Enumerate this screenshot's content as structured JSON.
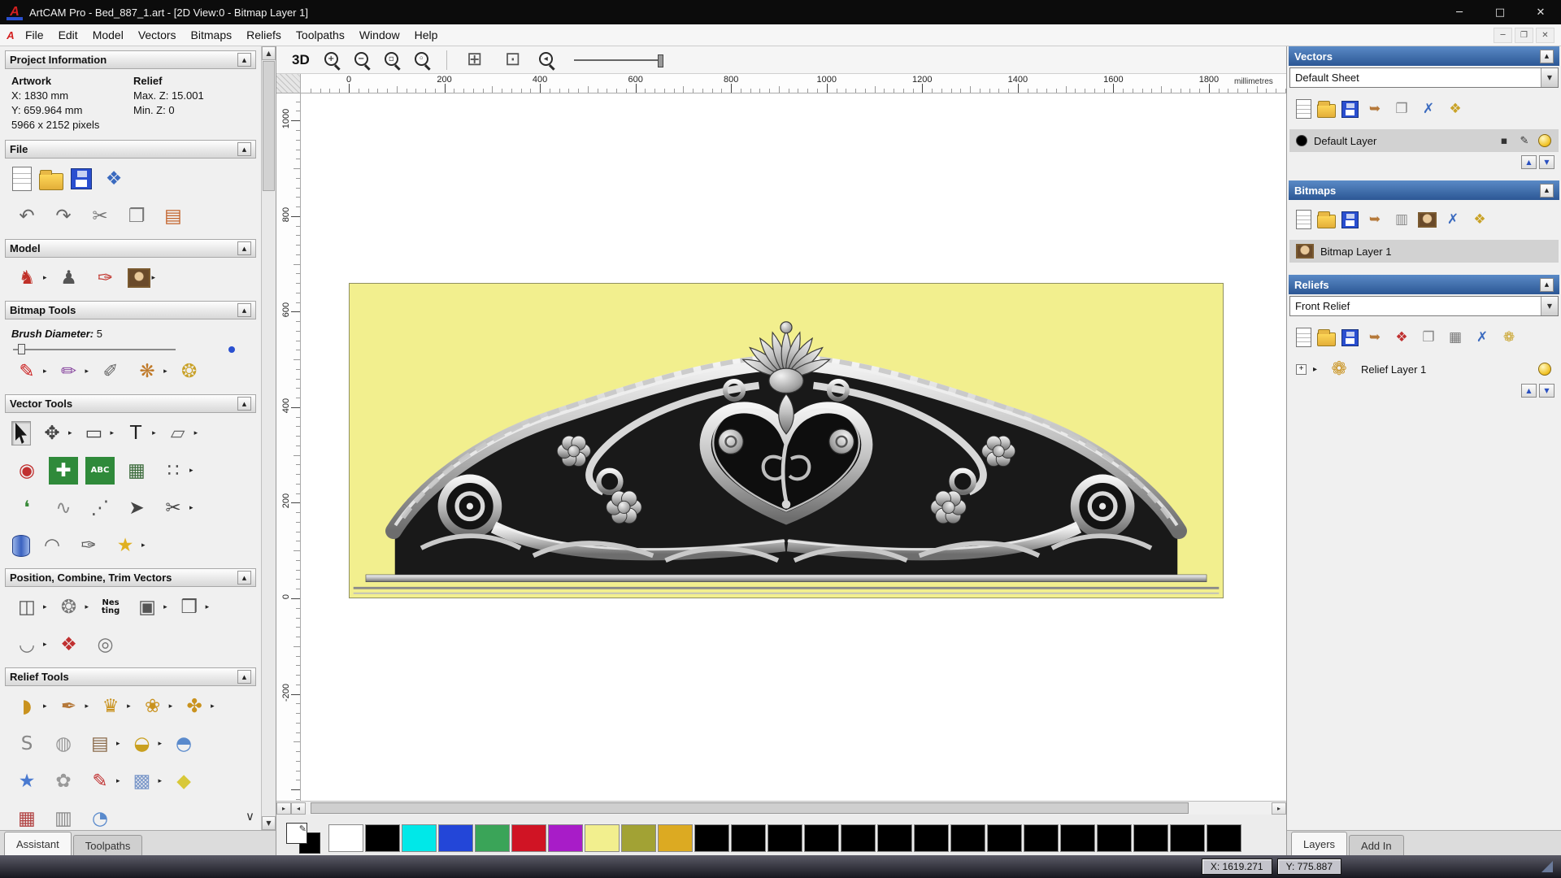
{
  "ui": {
    "collapse_glyph": "▲",
    "dropdown_glyph": "▼",
    "flyout_glyph": "▸",
    "up_glyph": "▲",
    "down_glyph": "▼",
    "left_glyph": "◂",
    "right_glyph": "▸",
    "more_glyph": "∨",
    "plus_glyph": "+",
    "pencil_glyph": "✎"
  },
  "window": {
    "logo_letter": "A",
    "title": "ArtCAM Pro - Bed_887_1.art - [2D View:0 - Bitmap Layer 1]",
    "buttons": [
      {
        "name": "minimize-button",
        "glyph": "─"
      },
      {
        "name": "maximize-button",
        "glyph": "□"
      },
      {
        "name": "close-button",
        "glyph": "✕"
      }
    ]
  },
  "menu": {
    "items": [
      "File",
      "Edit",
      "Model",
      "Vectors",
      "Bitmaps",
      "Reliefs",
      "Toolpaths",
      "Window",
      "Help"
    ],
    "mdi_buttons": [
      {
        "name": "mdi-minimize-button",
        "glyph": "─"
      },
      {
        "name": "mdi-restore-button",
        "glyph": "❐"
      },
      {
        "name": "mdi-close-button",
        "glyph": "✕"
      }
    ]
  },
  "left_panel": {
    "project_info": {
      "title": "Project Information",
      "artwork_label": "Artwork",
      "relief_label": "Relief",
      "x_value": "X: 1830 mm",
      "max_z": "Max. Z: 15.001",
      "y_value": "Y: 659.964 mm",
      "min_z": "Min. Z: 0",
      "pixels": "5966 x 2152 pixels"
    },
    "file": {
      "title": "File",
      "rows": [
        [
          {
            "name": "new-model-icon",
            "type": "page"
          },
          {
            "name": "open-model-icon",
            "type": "folder"
          },
          {
            "name": "save-model-icon",
            "type": "floppy"
          },
          {
            "name": "import-3d-model-icon",
            "type": "glyph",
            "glyph": "❖",
            "color": "#3a6abf"
          }
        ],
        [
          {
            "name": "undo-icon",
            "type": "glyph",
            "glyph": "↶",
            "color": "#666666"
          },
          {
            "name": "redo-icon",
            "type": "glyph",
            "glyph": "↷",
            "color": "#666666"
          },
          {
            "name": "cut-icon",
            "type": "glyph",
            "glyph": "✂",
            "color": "#777777"
          },
          {
            "name": "copy-icon",
            "type": "glyph",
            "glyph": "❐",
            "color": "#777777"
          },
          {
            "name": "paste-icon",
            "type": "glyph",
            "glyph": "▤",
            "color": "#c2622a"
          }
        ]
      ]
    },
    "model": {
      "title": "Model",
      "rows": [
        [
          {
            "name": "relief-from-model-icon",
            "type": "glyph",
            "glyph": "♞",
            "color": "#c03028",
            "flyout": true
          },
          {
            "name": "greyscale-model-icon",
            "type": "glyph",
            "glyph": "♟",
            "color": "#555555"
          },
          {
            "name": "sculpt-model-icon",
            "type": "glyph",
            "glyph": "✑",
            "color": "#c03028"
          },
          {
            "name": "model-image-icon",
            "type": "photo",
            "flyout": true
          }
        ]
      ]
    },
    "bitmap_tools": {
      "title": "Bitmap Tools",
      "brush_label": "Brush Diameter:",
      "brush_value": "5",
      "rows": [
        [
          {
            "name": "paint-icon",
            "type": "glyph",
            "glyph": "✎",
            "color": "#cc2020",
            "flyout": true
          },
          {
            "name": "paint-selective-icon",
            "type": "glyph",
            "glyph": "✏",
            "color": "#8a4aa0",
            "flyout": true
          },
          {
            "name": "colour-picker-icon",
            "type": "glyph",
            "glyph": "✐",
            "color": "#666666"
          },
          {
            "name": "palette-icon",
            "type": "glyph",
            "glyph": "❋",
            "color": "#c07a2a",
            "flyout": true
          },
          {
            "name": "flood-fill-icon",
            "type": "glyph",
            "glyph": "❂",
            "color": "#c9a22a"
          }
        ]
      ]
    },
    "vector_tools": {
      "title": "Vector Tools",
      "rows": [
        [
          {
            "name": "select-vectors-icon",
            "type": "cursor",
            "pressed": true
          },
          {
            "name": "transform-vectors-icon",
            "type": "glyph",
            "glyph": "✥",
            "color": "#444444",
            "flyout": true
          },
          {
            "name": "create-rectangle-icon",
            "type": "glyph",
            "glyph": "▭",
            "color": "#444444",
            "flyout": true
          },
          {
            "name": "create-text-icon",
            "type": "glyph",
            "glyph": "T",
            "color": "#222222",
            "flyout": true
          },
          {
            "name": "mirror-vectors-icon",
            "type": "glyph",
            "glyph": "▱",
            "color": "#666666",
            "flyout": true
          }
        ],
        [
          {
            "name": "offset-vectors-icon",
            "type": "glyph",
            "glyph": "◉",
            "color": "#c03030"
          },
          {
            "name": "create-polyline-icon",
            "type": "glyph",
            "glyph": "✚",
            "color": "#ffffff",
            "bg": "#2f8a3a"
          },
          {
            "name": "text-on-curve-icon",
            "type": "text2",
            "text": "ABC",
            "text2": "",
            "bg": "#2f8a3a",
            "color": "#ffffff"
          },
          {
            "name": "grid-icon",
            "type": "glyph",
            "glyph": "▦",
            "color": "#3a6a3a"
          },
          {
            "name": "snap-grid-icon",
            "type": "glyph",
            "glyph": "∷",
            "color": "#555555",
            "flyout": true
          }
        ],
        [
          {
            "name": "create-curve-icon",
            "type": "glyph",
            "glyph": "❛",
            "color": "#3a8a3a"
          },
          {
            "name": "free-curve-icon",
            "type": "glyph",
            "glyph": "∿",
            "color": "#888888"
          },
          {
            "name": "node-editing-icon",
            "type": "glyph",
            "glyph": "⋰",
            "color": "#555555"
          },
          {
            "name": "measure-icon",
            "type": "glyph",
            "glyph": "➤",
            "color": "#444444"
          },
          {
            "name": "trim-vectors-icon",
            "type": "glyph",
            "glyph": "✂",
            "color": "#444444",
            "flyout": true
          }
        ],
        [
          {
            "name": "wrap-cylinder-icon",
            "type": "cyl"
          },
          {
            "name": "arc-icon",
            "type": "glyph",
            "glyph": "◠",
            "color": "#666666"
          },
          {
            "name": "freehand-draw-icon",
            "type": "glyph",
            "glyph": "✑",
            "color": "#555555"
          },
          {
            "name": "magic-wand-icon",
            "type": "glyph",
            "glyph": "★",
            "color": "#e0b020",
            "flyout": true
          }
        ]
      ]
    },
    "position_tools": {
      "title": "Position, Combine, Trim Vectors",
      "rows": [
        [
          {
            "name": "block-copy-icon",
            "type": "glyph",
            "glyph": "◫",
            "color": "#555555",
            "flyout": true
          },
          {
            "name": "rotate-copy-icon",
            "type": "glyph",
            "glyph": "❂",
            "color": "#777777",
            "flyout": true
          },
          {
            "name": "nesting-icon",
            "type": "text2",
            "text": "Nes",
            "text2": "ting",
            "color": "#111111"
          },
          {
            "name": "align-objects-icon",
            "type": "glyph",
            "glyph": "▣",
            "color": "#555555",
            "flyout": true
          },
          {
            "name": "group-vectors-icon",
            "type": "glyph",
            "glyph": "❒",
            "color": "#555555",
            "flyout": true
          }
        ],
        [
          {
            "name": "join-vectors-icon",
            "type": "glyph",
            "glyph": "◡",
            "color": "#777777",
            "flyout": true
          },
          {
            "name": "weld-vectors-icon",
            "type": "glyph",
            "glyph": "❖",
            "color": "#c03030"
          },
          {
            "name": "spiral-icon",
            "type": "glyph",
            "glyph": "◎",
            "color": "#777777"
          }
        ]
      ]
    },
    "relief_tools": {
      "title": "Relief Tools",
      "rows": [
        [
          {
            "name": "shape-editor-icon",
            "type": "glyph",
            "glyph": "◗",
            "color": "#c9921e",
            "flyout": true
          },
          {
            "name": "smooth-relief-icon",
            "type": "glyph",
            "glyph": "✒",
            "color": "#b5793a",
            "flyout": true
          },
          {
            "name": "two-rail-sweep-icon",
            "type": "glyph",
            "glyph": "♛",
            "color": "#c9921e",
            "flyout": true
          },
          {
            "name": "extrude-icon",
            "type": "glyph",
            "glyph": "❀",
            "color": "#c9921e",
            "flyout": true
          },
          {
            "name": "turn-icon",
            "type": "glyph",
            "glyph": "✤",
            "color": "#c9921e",
            "flyout": true
          }
        ],
        [
          {
            "name": "isolines-icon",
            "type": "glyph",
            "glyph": "S",
            "color": "#888888"
          },
          {
            "name": "weave-wizard-icon",
            "type": "glyph",
            "glyph": "◍",
            "color": "#999999"
          },
          {
            "name": "relief-layers-icon",
            "type": "glyph",
            "glyph": "▤",
            "color": "#8a6a4a",
            "flyout": true
          },
          {
            "name": "dome-icon",
            "type": "glyph",
            "glyph": "◒",
            "color": "#c9a020",
            "flyout": true
          },
          {
            "name": "texture-dome-icon",
            "type": "glyph",
            "glyph": "◓",
            "color": "#5a8acc"
          }
        ],
        [
          {
            "name": "star-wizard-icon",
            "type": "glyph",
            "glyph": "★",
            "color": "#4a7ad0"
          },
          {
            "name": "swirl-icon",
            "type": "glyph",
            "glyph": "✿",
            "color": "#999999"
          },
          {
            "name": "smudge-icon",
            "type": "glyph",
            "glyph": "✎",
            "color": "#c03030",
            "flyout": true
          },
          {
            "name": "texture-relief-icon",
            "type": "glyph",
            "glyph": "▩",
            "color": "#7a97c9",
            "flyout": true
          },
          {
            "name": "offset-relief-icon",
            "type": "glyph",
            "glyph": "◆",
            "color": "#d8c838"
          }
        ],
        [
          {
            "name": "clipped-tool-icon-1",
            "type": "glyph",
            "glyph": "▦",
            "color": "#b04040"
          },
          {
            "name": "clipped-tool-icon-2",
            "type": "glyph",
            "glyph": "▥",
            "color": "#888888"
          },
          {
            "name": "clipped-tool-icon-3",
            "type": "glyph",
            "glyph": "◔",
            "color": "#5a8acc"
          }
        ]
      ]
    },
    "tabs": [
      {
        "label": "Assistant",
        "active": true
      },
      {
        "label": "Toolpaths",
        "active": false
      }
    ]
  },
  "canvas": {
    "toolbar": {
      "view_3d_label": "3D",
      "icons": [
        {
          "name": "zoom-in-icon",
          "type": "mag",
          "sub": "+"
        },
        {
          "name": "zoom-out-icon",
          "type": "mag",
          "sub": "−"
        },
        {
          "name": "zoom-page-icon",
          "type": "mag",
          "sub": "▫"
        },
        {
          "name": "zoom-objects-icon",
          "type": "mag",
          "sub": "◦"
        },
        {
          "type": "sep"
        },
        {
          "name": "snap-toggle-icon",
          "type": "glyph",
          "glyph": "⊞",
          "color": "#555555"
        },
        {
          "name": "centre-view-icon",
          "type": "glyph",
          "glyph": "⊡",
          "color": "#555555"
        },
        {
          "name": "zoom-previous-icon",
          "type": "mag",
          "sub": "◂"
        },
        {
          "name": "line-width-slider",
          "type": "slider"
        }
      ]
    },
    "ruler": {
      "h_labels": [
        "0",
        "200",
        "400",
        "600",
        "800",
        "1000",
        "1200",
        "1400",
        "1600",
        "1800"
      ],
      "v_labels": [
        "1000",
        "800",
        "600",
        "400",
        "200",
        "0",
        "-200"
      ],
      "unit": "millimetres"
    }
  },
  "right_panel": {
    "vectors": {
      "title": "Vectors",
      "sheet_value": "Default Sheet",
      "toolbar": [
        {
          "name": "new-vector-layer-icon",
          "type": "page"
        },
        {
          "name": "open-vector-layer-icon",
          "type": "folder"
        },
        {
          "name": "save-vector-layer-icon",
          "type": "floppy"
        },
        {
          "name": "import-vectors-icon",
          "type": "glyph",
          "glyph": "➥",
          "color": "#b5793a"
        },
        {
          "name": "export-vectors-icon",
          "type": "glyph",
          "glyph": "❐",
          "color": "#888888"
        },
        {
          "name": "delete-vector-layer-icon",
          "type": "glyph",
          "glyph": "✗",
          "color": "#3a6abf"
        },
        {
          "name": "merge-vector-layers-icon",
          "type": "glyph",
          "glyph": "❖",
          "color": "#c9a227"
        }
      ],
      "layer": {
        "name": "Default Layer"
      },
      "layer_icons": [
        {
          "name": "layer-snap-icon",
          "type": "glyph",
          "glyph": "▪",
          "color": "#333333"
        },
        {
          "name": "layer-edit-icon",
          "type": "glyph",
          "glyph": "✎",
          "color": "#333333"
        },
        {
          "name": "layer-visibility-bulb",
          "type": "bulb"
        }
      ]
    },
    "bitmaps": {
      "title": "Bitmaps",
      "toolbar": [
        {
          "name": "new-bitmap-layer-icon",
          "type": "page"
        },
        {
          "name": "open-bitmap-layer-icon",
          "type": "folder"
        },
        {
          "name": "save-bitmap-layer-icon",
          "type": "floppy"
        },
        {
          "name": "import-bitmap-icon",
          "type": "glyph",
          "glyph": "➥",
          "color": "#b5793a"
        },
        {
          "name": "greyscale-bitmap-icon",
          "type": "glyph",
          "glyph": "▥",
          "color": "#888888"
        },
        {
          "name": "bitmap-preview-icon",
          "type": "photo"
        },
        {
          "name": "delete-bitmap-layer-icon",
          "type": "glyph",
          "glyph": "✗",
          "color": "#3a6abf"
        },
        {
          "name": "merge-bitmap-layers-icon",
          "type": "glyph",
          "glyph": "❖",
          "color": "#c9a227"
        }
      ],
      "layer": {
        "name": "Bitmap Layer 1"
      }
    },
    "reliefs": {
      "title": "Reliefs",
      "relief_value": "Front Relief",
      "toolbar": [
        {
          "name": "new-relief-layer-icon",
          "type": "page"
        },
        {
          "name": "open-relief-layer-icon",
          "type": "folder"
        },
        {
          "name": "save-relief-layer-icon",
          "type": "floppy"
        },
        {
          "name": "import-relief-icon",
          "type": "glyph",
          "glyph": "➥",
          "color": "#b5793a"
        },
        {
          "name": "relief-wizard-icon",
          "type": "glyph",
          "glyph": "❖",
          "color": "#c03030"
        },
        {
          "name": "duplicate-relief-icon",
          "type": "glyph",
          "glyph": "❐",
          "color": "#888888"
        },
        {
          "name": "calculate-relief-icon",
          "type": "glyph",
          "glyph": "▦",
          "color": "#777777"
        },
        {
          "name": "delete-relief-layer-icon",
          "type": "glyph",
          "glyph": "✗",
          "color": "#3a6abf"
        },
        {
          "name": "merge-relief-layers-icon",
          "type": "glyph",
          "glyph": "❁",
          "color": "#c9a227"
        }
      ],
      "layer": {
        "name": "Relief Layer 1"
      },
      "layer_leading_icons": [
        {
          "name": "relief-thumbnail-icon",
          "type": "glyph",
          "glyph": "❁",
          "color": "#c9921e"
        }
      ],
      "layer_icons": [
        {
          "name": "relief-visibility-bulb",
          "type": "bulb"
        }
      ]
    },
    "tabs": [
      {
        "label": "Layers",
        "active": true
      },
      {
        "label": "Add In",
        "active": false
      }
    ]
  },
  "palette": {
    "colors": [
      "#ffffff",
      "#000000",
      "#00e8e8",
      "#2346d8",
      "#3aa458",
      "#d01424",
      "#a81cc8",
      "#f2ef8e",
      "#a2a234",
      "#dcaa22",
      "#000000",
      "#000000",
      "#000000",
      "#000000",
      "#000000",
      "#000000",
      "#000000",
      "#000000",
      "#000000",
      "#000000",
      "#000000",
      "#000000",
      "#000000",
      "#000000",
      "#000000"
    ]
  },
  "status_bar": {
    "x_value": "X: 1619.271",
    "y_value": "Y: 775.887"
  }
}
